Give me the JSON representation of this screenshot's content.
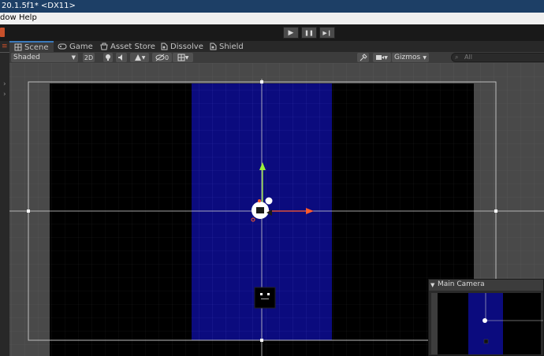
{
  "window": {
    "title": "20.1.5f1* <DX11>"
  },
  "menu": {
    "items": [
      "dow",
      "Help"
    ]
  },
  "toolbar": {
    "play_icon": "▶",
    "pause_icon": "❚❚",
    "step_icon": "▶❙"
  },
  "tabs": [
    {
      "label": "Scene",
      "icon": "grid-icon"
    },
    {
      "label": "Game",
      "icon": "gamepad-icon"
    },
    {
      "label": "Asset Store",
      "icon": "store-icon"
    },
    {
      "label": "Dissolve",
      "icon": "shader-icon"
    },
    {
      "label": "Shield",
      "icon": "shader-icon"
    }
  ],
  "scene_toolbar": {
    "draw_mode": "Shaded",
    "mode_2d": "2D",
    "hidden_count": "0",
    "gizmos": "Gizmos",
    "search_placeholder": "All"
  },
  "camera_preview": {
    "title": "Main Camera"
  },
  "colors": {
    "blue_panel": "#0b0b7e",
    "move_x": "#ff5a2a",
    "move_y": "#9bef3a",
    "tab_accent": "#3a79bb"
  }
}
